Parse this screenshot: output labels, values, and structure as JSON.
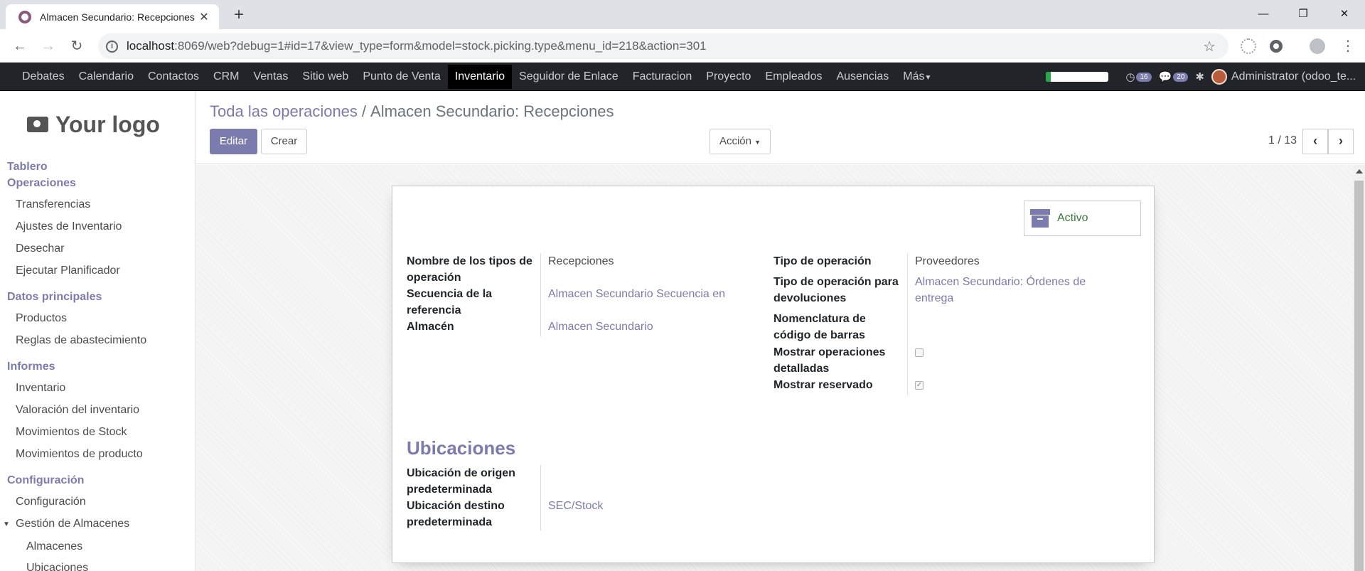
{
  "browser": {
    "tab_title": "Almacen Secundario: Recepciones",
    "new_tab": "+",
    "url_host": "localhost",
    "url_rest": ":8069/web?debug=1#id=17&view_type=form&model=stock.picking.type&menu_id=218&action=301"
  },
  "navbar": {
    "menu": [
      "Debates",
      "Calendario",
      "Contactos",
      "CRM",
      "Ventas",
      "Sitio web",
      "Punto de Venta",
      "Inventario",
      "Seguidor de Enlace",
      "Facturacion",
      "Proyecto",
      "Empleados",
      "Ausencias",
      "Más"
    ],
    "active": "Inventario",
    "progress": 0.08,
    "activity_count": "16",
    "message_count": "20",
    "user": "Administrator (odoo_te..."
  },
  "sidebar": {
    "logo": "Your logo",
    "sections": [
      {
        "title": "Tablero",
        "items": []
      },
      {
        "title": "Operaciones",
        "items": [
          "Transferencias",
          "Ajustes de Inventario",
          "Desechar",
          "Ejecutar Planificador"
        ]
      },
      {
        "title": "Datos principales",
        "items": [
          "Productos",
          "Reglas de abastecimiento"
        ]
      },
      {
        "title": "Informes",
        "items": [
          "Inventario",
          "Valoración del inventario",
          "Movimientos de Stock",
          "Movimientos de producto"
        ]
      },
      {
        "title": "Configuración",
        "items": [
          "Configuración",
          "Gestión de Almacenes"
        ]
      }
    ],
    "sub_items": [
      "Almacenes",
      "Ubicaciones"
    ]
  },
  "control": {
    "breadcrumb_parent": "Toda las operaciones",
    "breadcrumb_sep": "/",
    "breadcrumb_current": "Almacen Secundario: Recepciones",
    "edit_label": "Editar",
    "create_label": "Crear",
    "action_label": "Acción",
    "pager": "1 / 13"
  },
  "form": {
    "active_button": "Activo",
    "left_fields": [
      {
        "label": "Nombre de los tipos de operación",
        "value": "Recepciones",
        "link": false
      },
      {
        "label": "Secuencia de la referencia",
        "value": "Almacen Secundario Secuencia en",
        "link": true
      },
      {
        "label": "Almacén",
        "value": "Almacen Secundario",
        "link": true
      }
    ],
    "right_fields": [
      {
        "label": "Tipo de operación",
        "value": "Proveedores"
      },
      {
        "label": "Tipo de operación para devoluciones",
        "value": "Almacen Secundario: Órdenes de entrega"
      },
      {
        "label": "Nomenclatura de código de barras",
        "value": ""
      },
      {
        "label": "Mostrar operaciones detalladas",
        "checked": false
      },
      {
        "label": "Mostrar reservado",
        "checked": true
      }
    ],
    "locations_title": "Ubicaciones",
    "location_fields": [
      {
        "label": "Ubicación de origen predeterminada",
        "value": ""
      },
      {
        "label": "Ubicación destino predeterminada",
        "value": "SEC/Stock"
      }
    ]
  }
}
